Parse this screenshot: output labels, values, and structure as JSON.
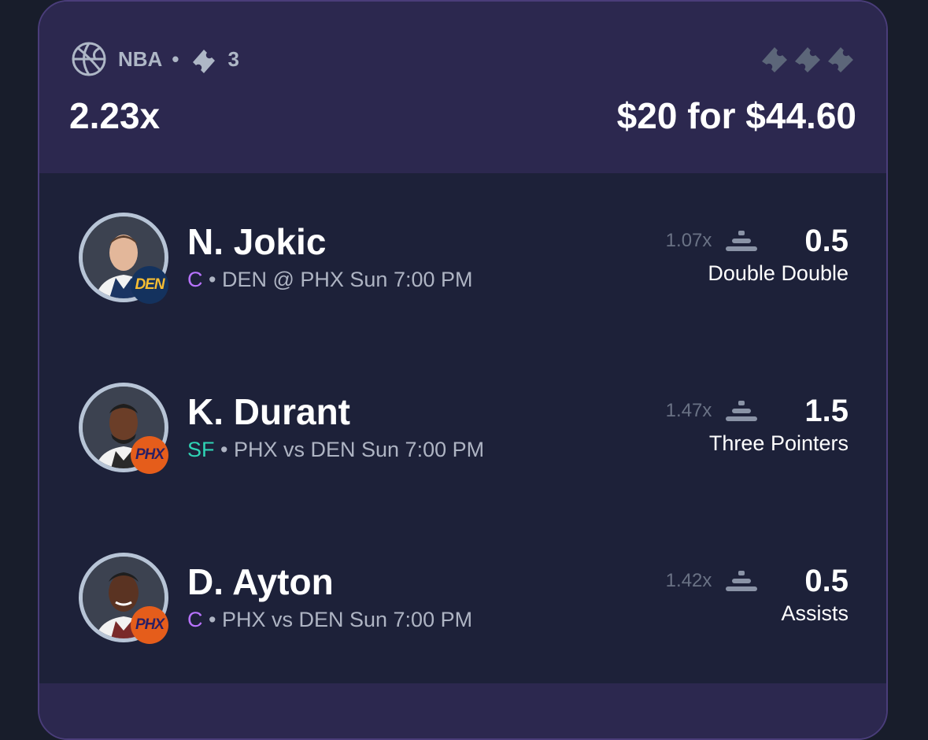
{
  "header": {
    "league": "NBA",
    "separator": "•",
    "ticket_count": "3",
    "multiplier": "2.23x",
    "payout": "$20 for $44.60"
  },
  "icons": {
    "sport": "basketball-icon",
    "ticket": "ticket-icon",
    "line_type": "stacked-lines-icon"
  },
  "colors": {
    "header_bg": "#2c284f",
    "body_bg": "#1d2139",
    "position_c": "#b873ff",
    "position_sf": "#2fd4b5",
    "den_badge": "#14325e",
    "phx_badge": "#e55d1b"
  },
  "picks": [
    {
      "name": "N. Jokic",
      "position": "C",
      "game": "• DEN @ PHX Sun 7:00 PM",
      "team": "DEN",
      "multiplier": "1.07x",
      "line": "0.5",
      "stat": "Double Double"
    },
    {
      "name": "K. Durant",
      "position": "SF",
      "game": "• PHX vs DEN Sun 7:00 PM",
      "team": "PHX",
      "multiplier": "1.47x",
      "line": "1.5",
      "stat": "Three Pointers"
    },
    {
      "name": "D. Ayton",
      "position": "C",
      "game": "• PHX vs DEN Sun 7:00 PM",
      "team": "PHX",
      "multiplier": "1.42x",
      "line": "0.5",
      "stat": "Assists"
    }
  ]
}
